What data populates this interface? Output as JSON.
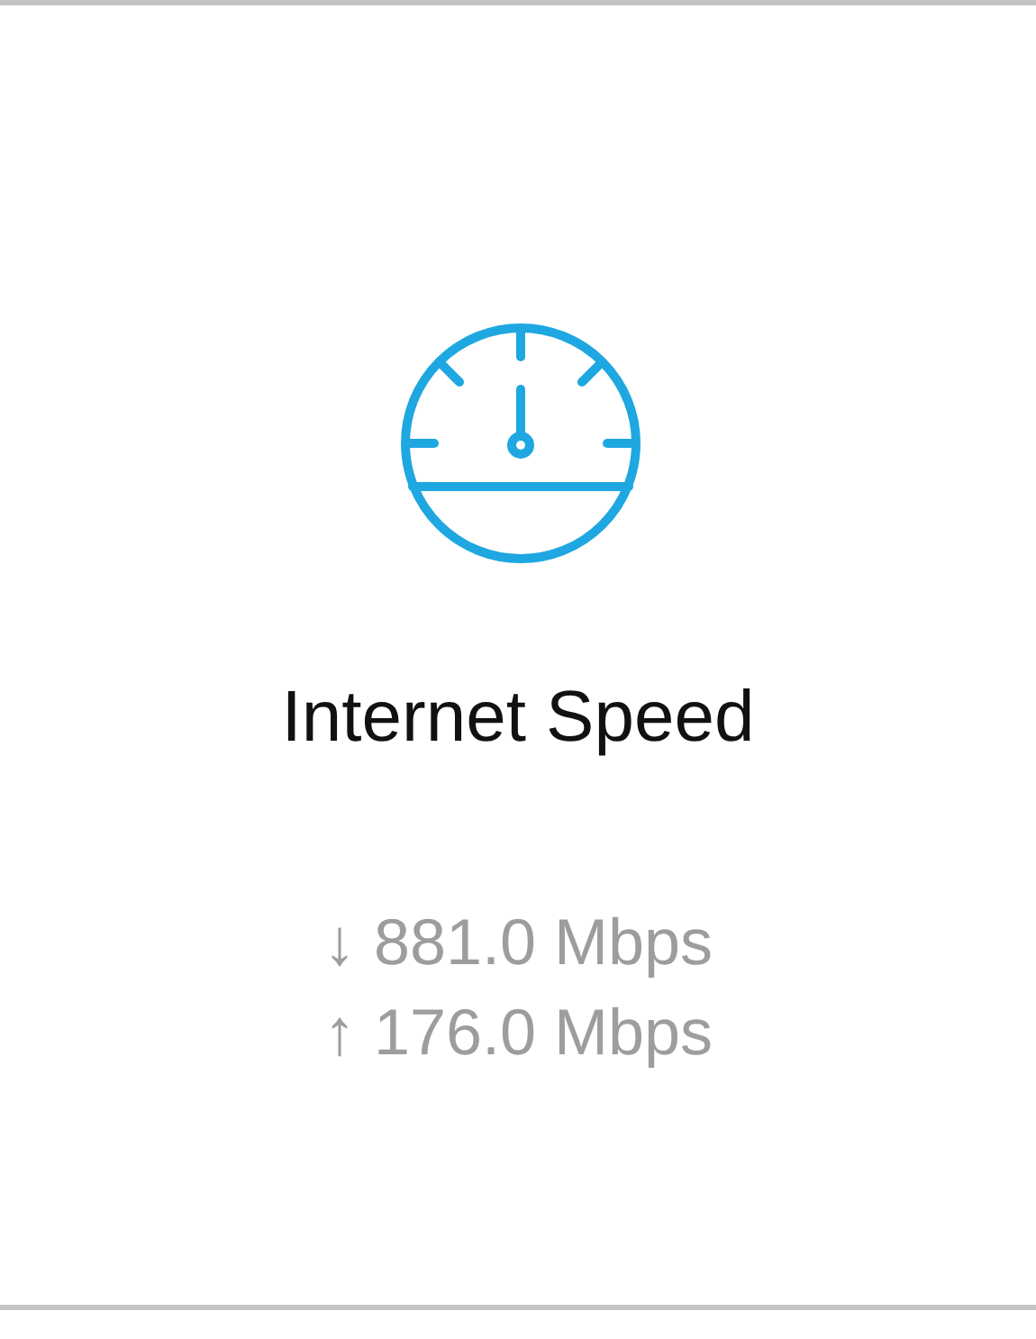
{
  "card": {
    "title": "Internet Speed",
    "speeds": [
      {
        "kind": "download",
        "text": "↓ 881.0 Mbps"
      },
      {
        "kind": "upload",
        "text": "↑ 176.0 Mbps"
      }
    ]
  }
}
